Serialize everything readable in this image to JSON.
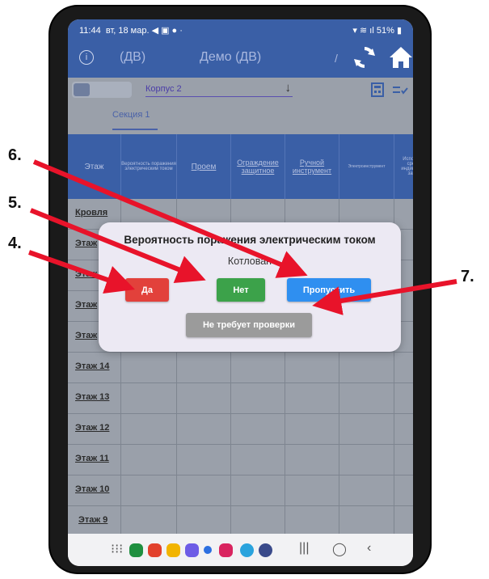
{
  "status": {
    "time": "11:44",
    "date": "вт, 18 мар.",
    "battery": "51%"
  },
  "appbar": {
    "subtitle": "(ДВ)",
    "title": "Демо (ДВ)",
    "info_icon": "info-icon",
    "sync_icon": "sync-icon",
    "home_icon": "home-icon"
  },
  "toolbar": {
    "select_value": "Корпус 2"
  },
  "tabs": [
    {
      "label": "Секция 1"
    }
  ],
  "table": {
    "headers": [
      "Этаж",
      "Вероятность поражения электрическим током",
      "Проем",
      "Ограждение защитное",
      "Ручной инструмент",
      "Электроинструмент",
      "Использов средст индивидуал защит"
    ],
    "rows": [
      "Кровля",
      "Этаж",
      "Этаж",
      "Этаж",
      "Этаж",
      "Этаж 14",
      "Этаж 13",
      "Этаж 12",
      "Этаж 11",
      "Этаж 10",
      "Этаж 9"
    ]
  },
  "dialog": {
    "title": "Вероятность поражения электрическим током",
    "subtitle": "Котлован",
    "yes_label": "Да",
    "no_label": "Нет",
    "skip_label": "Пропустить",
    "not_required_label": "Не требует проверки"
  },
  "annotations": [
    "4.",
    "5.",
    "6.",
    "7."
  ],
  "colors": {
    "primary": "#3a5fa6",
    "yes": "#e2413b",
    "no": "#3ca24a",
    "skip": "#2f8ff0",
    "not_required": "#9b9b9b",
    "arrow": "#e8132a"
  }
}
